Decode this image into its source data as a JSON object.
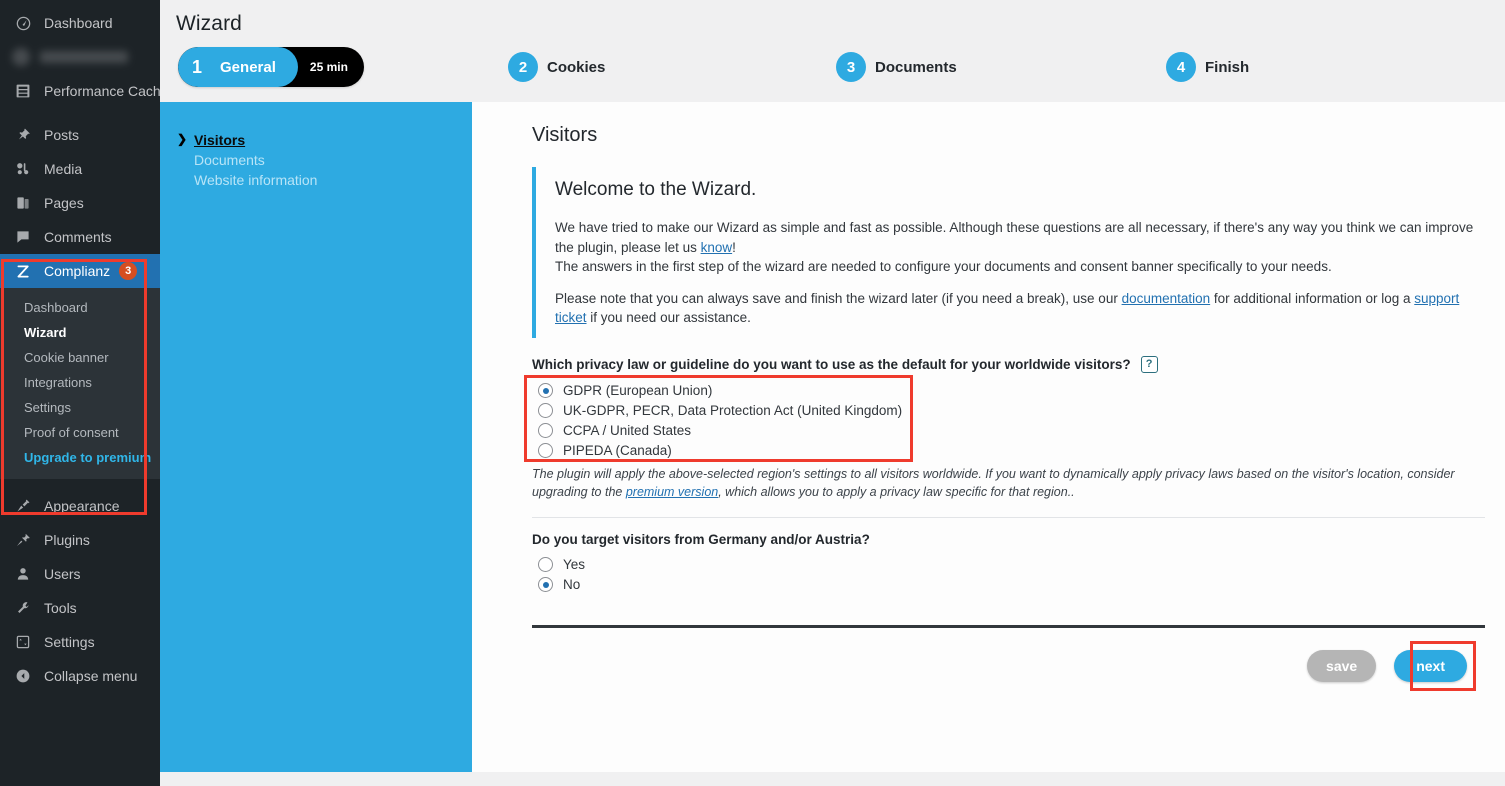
{
  "wp_sidebar": {
    "items": [
      {
        "label": "Dashboard",
        "icon": "dashboard-icon"
      },
      {
        "label": "",
        "icon": "redacted-icon",
        "redacted": true
      },
      {
        "label": "Performance Cache",
        "icon": "server-icon"
      },
      {
        "label": "Posts",
        "icon": "pin-icon"
      },
      {
        "label": "Media",
        "icon": "media-icon"
      },
      {
        "label": "Pages",
        "icon": "pages-icon"
      },
      {
        "label": "Comments",
        "icon": "comment-icon"
      }
    ],
    "complianz": {
      "label": "Complianz",
      "icon": "complianz-icon",
      "badge": "3",
      "submenu": [
        {
          "label": "Dashboard",
          "state": "normal"
        },
        {
          "label": "Wizard",
          "state": "current"
        },
        {
          "label": "Cookie banner",
          "state": "normal"
        },
        {
          "label": "Integrations",
          "state": "normal"
        },
        {
          "label": "Settings",
          "state": "normal"
        },
        {
          "label": "Proof of consent",
          "state": "normal"
        },
        {
          "label": "Upgrade to premium",
          "state": "premium"
        }
      ]
    },
    "bottom_items": [
      {
        "label": "Appearance",
        "icon": "brush-icon"
      },
      {
        "label": "Plugins",
        "icon": "plug-icon"
      },
      {
        "label": "Users",
        "icon": "user-icon"
      },
      {
        "label": "Tools",
        "icon": "wrench-icon"
      },
      {
        "label": "Settings",
        "icon": "sliders-icon"
      },
      {
        "label": "Collapse menu",
        "icon": "collapse-arrow-icon"
      }
    ]
  },
  "header": {
    "title": "Wizard"
  },
  "steps": [
    {
      "number": "1",
      "label": "General",
      "time": "25 min",
      "state": "active"
    },
    {
      "number": "2",
      "label": "Cookies",
      "state": "upcoming"
    },
    {
      "number": "3",
      "label": "Documents",
      "state": "upcoming"
    },
    {
      "number": "4",
      "label": "Finish",
      "state": "upcoming"
    }
  ],
  "sub_nav": [
    {
      "label": "Visitors",
      "state": "current"
    },
    {
      "label": "Documents",
      "state": "normal"
    },
    {
      "label": "Website information",
      "state": "normal"
    }
  ],
  "main": {
    "section_title": "Visitors",
    "notice": {
      "heading": "Welcome to the Wizard.",
      "p1_before": "We have tried to make our Wizard as simple and fast as possible. Although these questions are all necessary, if there's any way you think we can improve the plugin, please let us ",
      "p1_link": "know",
      "p1_after": "!",
      "p2": "The answers in the first step of the wizard are needed to configure your documents and consent banner specifically to your needs.",
      "p3_a": "Please note that you can always save and finish the wizard later (if you need a break), use our ",
      "p3_link1": "documentation",
      "p3_b": " for additional information or log a ",
      "p3_link2": "support ticket",
      "p3_c": " if you need our assistance."
    },
    "question1": {
      "label": "Which privacy law or guideline do you want to use as the default for your worldwide visitors?",
      "help_icon": "?",
      "options": [
        {
          "label": "GDPR (European Union)",
          "selected": true
        },
        {
          "label": "UK-GDPR, PECR, Data Protection Act (United Kingdom)",
          "selected": false
        },
        {
          "label": "CCPA / United States",
          "selected": false
        },
        {
          "label": "PIPEDA (Canada)",
          "selected": false
        }
      ],
      "note_a": "The plugin will apply the above-selected region's settings to all visitors worldwide. If you want to dynamically apply privacy laws based on the visitor's location, consider upgrading to the ",
      "note_link": "premium version",
      "note_b": ", which allows you to apply a privacy law specific for that region.."
    },
    "question2": {
      "label": "Do you target visitors from Germany and/or Austria?",
      "options": [
        {
          "label": "Yes",
          "selected": false
        },
        {
          "label": "No",
          "selected": true
        }
      ]
    },
    "buttons": {
      "save": "save",
      "next": "next"
    }
  },
  "colors": {
    "accent_blue": "#2eaae1",
    "wp_dark": "#1d2327",
    "wp_blue": "#2271b1",
    "badge_orange": "#d54e21",
    "highlight_red": "#ef3b2d",
    "link_blue": "#2271b1"
  }
}
